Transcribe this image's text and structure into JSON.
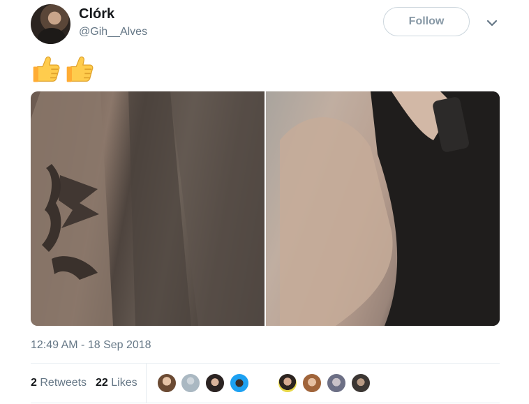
{
  "user": {
    "display_name": "Clórk",
    "handle": "@Gih__Alves"
  },
  "follow_label": "Follow",
  "tweet": {
    "emoji": [
      "thumbs-up",
      "thumbs-up"
    ],
    "timestamp": "12:49 AM - 18 Sep 2018"
  },
  "stats": {
    "retweets_count": "2",
    "retweets_label": "Retweets",
    "likes_count": "22",
    "likes_label": "Likes"
  },
  "colors": {
    "muted_text": "#657786",
    "follow_border": "#ccd6dd",
    "divider": "#e6ecf0"
  }
}
